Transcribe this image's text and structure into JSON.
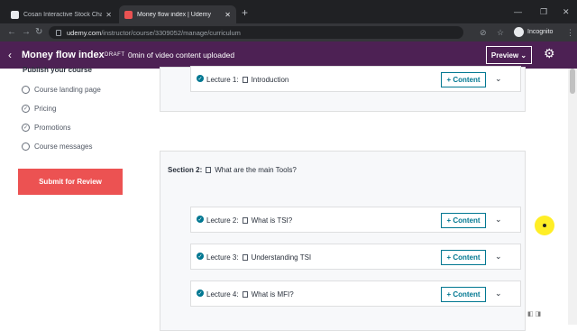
{
  "browser": {
    "tabs": [
      {
        "title": "Cosan Interactive Stock Chart (CZZ)",
        "active": false,
        "favicon_color": "#e8eaed"
      },
      {
        "title": "Money flow index | Udemy",
        "active": true,
        "favicon_color": "#ea5252"
      }
    ],
    "url_host": "udemy.com",
    "url_path": "/instructor/course/3309052/manage/curriculum",
    "profile_label": "Incognito"
  },
  "header": {
    "course_title": "Money flow index",
    "status": "DRAFT",
    "upload_status": "0min of video content uploaded",
    "preview_label": "Preview ⌄"
  },
  "sidebar": {
    "heading": "Publish your course",
    "items": [
      {
        "label": "Course landing page",
        "checked": false
      },
      {
        "label": "Pricing",
        "checked": true
      },
      {
        "label": "Promotions",
        "checked": true
      },
      {
        "label": "Course messages",
        "checked": false
      }
    ],
    "submit_label": "Submit for Review"
  },
  "curriculum": {
    "top_lecture": {
      "label": "Lecture 1:",
      "name": "Introduction"
    },
    "section2": {
      "label": "Section 2:",
      "name": "What are the main Tools?"
    },
    "lectures": [
      {
        "label": "Lecture 2:",
        "name": "What is TSI?"
      },
      {
        "label": "Lecture 3:",
        "name": "Understanding TSI"
      },
      {
        "label": "Lecture 4:",
        "name": "What is MFI?"
      }
    ],
    "add_content_label": "+ Content"
  },
  "colors": {
    "header_bg": "#4d2154",
    "accent": "#007791",
    "submit_bg": "#ec5252"
  }
}
